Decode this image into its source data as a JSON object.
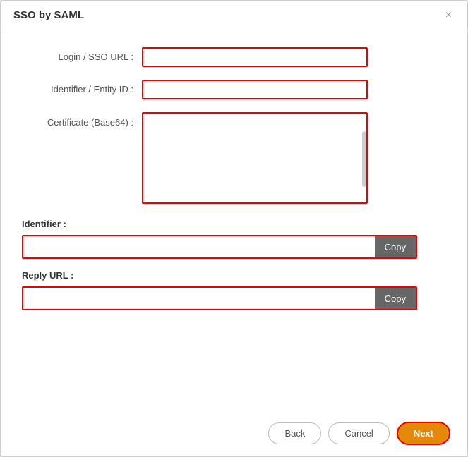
{
  "dialog": {
    "title": "SSO by SAML",
    "close_label": "×"
  },
  "form": {
    "login_sso_url_label": "Login / SSO URL :",
    "identifier_entity_id_label": "Identifier / Entity ID :",
    "certificate_label": "Certificate (Base64) :",
    "login_sso_url_value": "",
    "login_sso_url_placeholder": "",
    "identifier_entity_id_value": "",
    "identifier_entity_id_placeholder": "",
    "certificate_value": "",
    "certificate_placeholder": ""
  },
  "identifier_section": {
    "label": "Identifier :",
    "value": "",
    "copy_label": "Copy"
  },
  "reply_url_section": {
    "label": "Reply URL :",
    "value": "",
    "copy_label": "Copy"
  },
  "footer": {
    "back_label": "Back",
    "cancel_label": "Cancel",
    "next_label": "Next"
  }
}
